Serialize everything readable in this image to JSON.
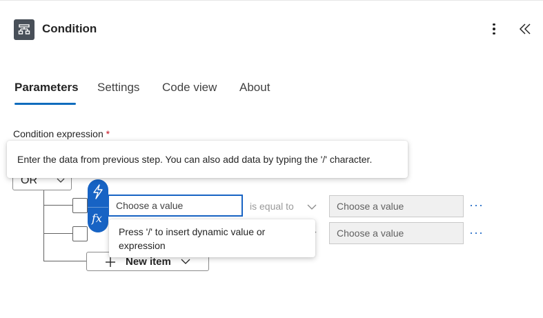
{
  "header": {
    "title": "Condition",
    "icon": "condition-icon",
    "more_icon": "more-vertical-icon",
    "collapse_icon": "double-chevron-left-icon"
  },
  "tabs": [
    {
      "label": "Parameters",
      "active": true
    },
    {
      "label": "Settings",
      "active": false
    },
    {
      "label": "Code view",
      "active": false
    },
    {
      "label": "About",
      "active": false
    }
  ],
  "condition": {
    "label": "Condition expression",
    "required_mark": "*",
    "group_operator": "OR",
    "rows": [
      {
        "left_placeholder": "Choose a value",
        "operator": "is equal to",
        "right_placeholder": "Choose a value",
        "more": "···"
      },
      {
        "left_placeholder": "",
        "operator": "",
        "right_placeholder": "Choose a value",
        "more": "···"
      }
    ],
    "new_item_label": "New item"
  },
  "tooltips": {
    "dynamic_content": "Enter the data from previous step. You can also add data by typing the '/' character.",
    "insert_hint": "Press '/' to insert dynamic value or expression"
  },
  "dynamic_buttons": {
    "dynamic_icon": "lightning-icon",
    "expression_label": "fx"
  },
  "colors": {
    "accent": "#0f6cbd",
    "dynamic_pill": "#1763c4",
    "required": "#c50f1f",
    "header_icon_bg": "#484f58"
  }
}
